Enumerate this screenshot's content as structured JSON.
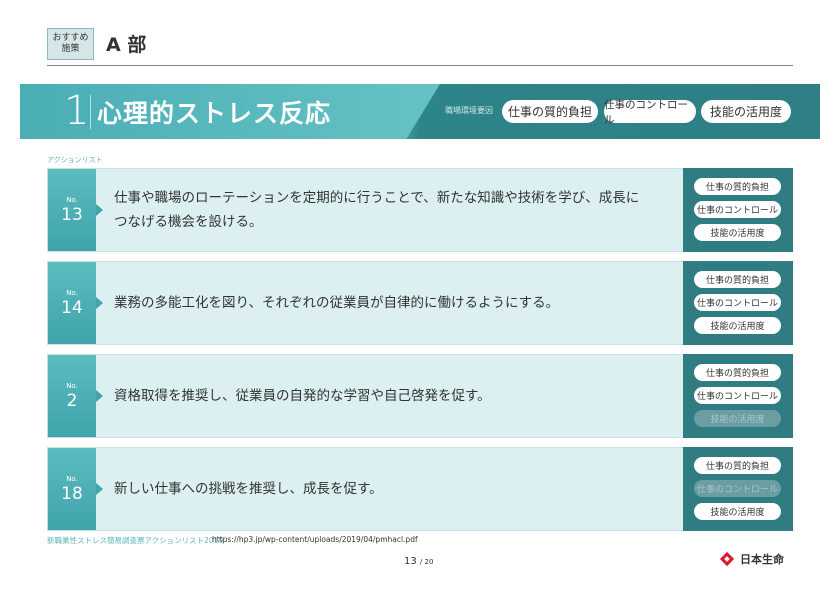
{
  "header": {
    "badge_line1": "おすすめ",
    "badge_line2": "施策",
    "title": "A 部"
  },
  "banner": {
    "number": "1",
    "title": "心理的ストレス反応",
    "env_label": "職場環境要因",
    "pills": [
      "仕事の質的負担",
      "仕事のコントロール",
      "技能の活用度"
    ]
  },
  "action_list_label": "アクションリスト",
  "cards": [
    {
      "no_label": "No.",
      "number": "13",
      "text_line1": "仕事や職場のローテーションを定期的に行うことで、新たな知識や技術を学び、成長に",
      "text_line2": "つなげる機会を設ける。",
      "tags": [
        {
          "label": "仕事の質的負担",
          "active": true
        },
        {
          "label": "仕事のコントロール",
          "active": true
        },
        {
          "label": "技能の活用度",
          "active": true
        }
      ]
    },
    {
      "no_label": "No.",
      "number": "14",
      "text_line1": "業務の多能工化を図り、それぞれの従業員が自律的に働けるようにする。",
      "text_line2": "",
      "tags": [
        {
          "label": "仕事の質的負担",
          "active": true
        },
        {
          "label": "仕事のコントロール",
          "active": true
        },
        {
          "label": "技能の活用度",
          "active": true
        }
      ]
    },
    {
      "no_label": "No.",
      "number": "2",
      "text_line1": "資格取得を推奨し、従業員の自発的な学習や自己啓発を促す。",
      "text_line2": "",
      "tags": [
        {
          "label": "仕事の質的負担",
          "active": true
        },
        {
          "label": "仕事のコントロール",
          "active": true
        },
        {
          "label": "技能の活用度",
          "active": false
        }
      ]
    },
    {
      "no_label": "No.",
      "number": "18",
      "text_line1": "新しい仕事への挑戦を推奨し、成長を促す。",
      "text_line2": "",
      "tags": [
        {
          "label": "仕事の質的負担",
          "active": true
        },
        {
          "label": "仕事のコントロール",
          "active": false
        },
        {
          "label": "技能の活用度",
          "active": true
        }
      ]
    }
  ],
  "footer": {
    "source": "新職業性ストレス簡易調査票アクションリスト2019",
    "url": "https://hp3.jp/wp-content/uploads/2019/04/pmhacl.pdf",
    "page_current": "13",
    "page_total": "/ 20",
    "logo_text": "日本生命"
  },
  "colors": {
    "teal_primary": "#4fb1b7",
    "teal_dark": "#2f7c82",
    "card_bg": "#dcf0f1",
    "logo_red": "#d7192b"
  }
}
